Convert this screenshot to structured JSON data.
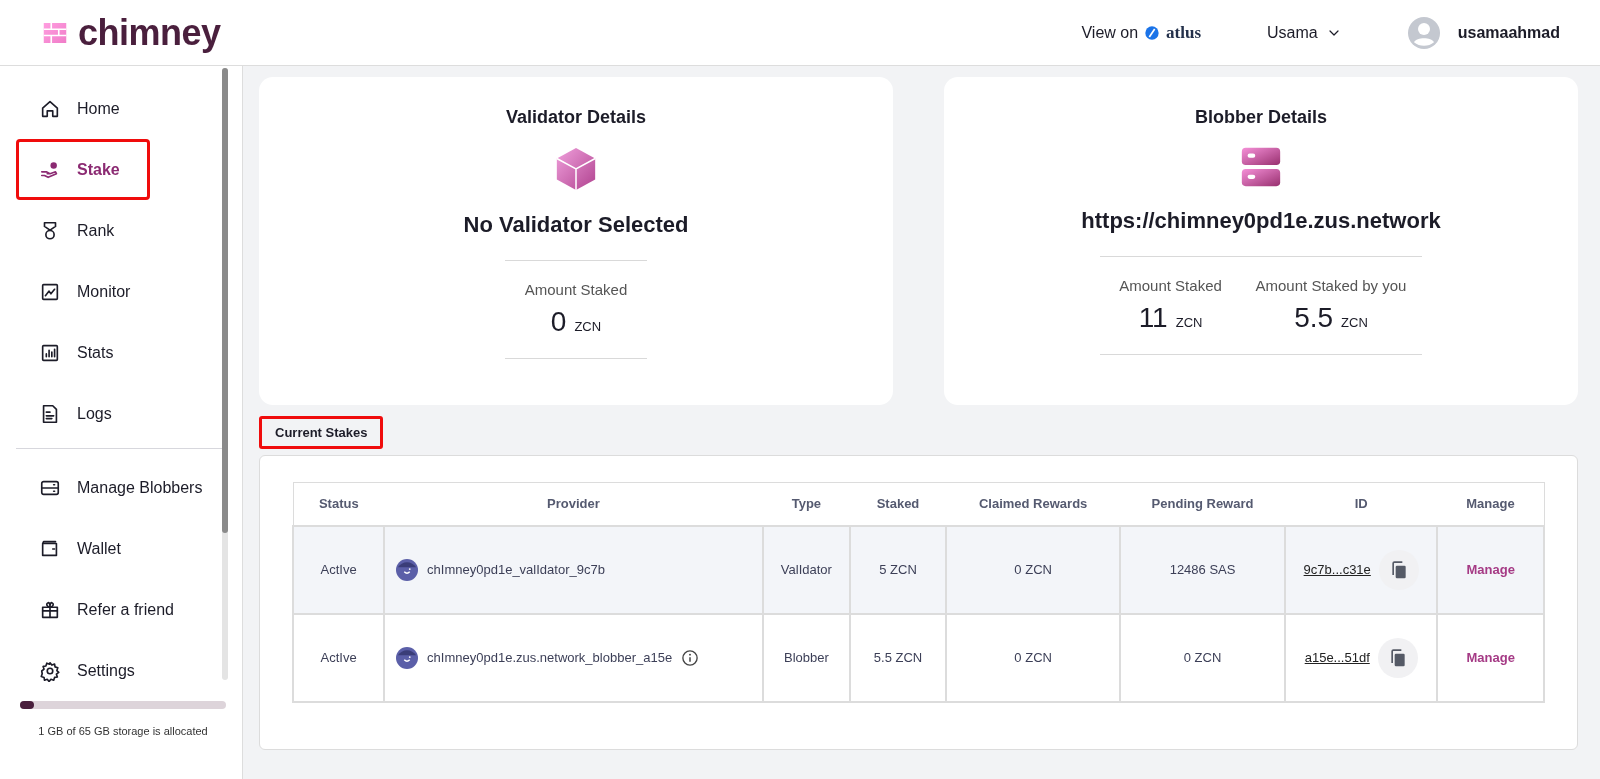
{
  "header": {
    "logo_text": "chimney",
    "view_on": "View on",
    "atlus": "atlus",
    "account": "Usama",
    "username": "usamaahmad"
  },
  "sidebar": {
    "items": [
      {
        "label": "Home",
        "selected": false,
        "annotated": false
      },
      {
        "label": "Stake",
        "selected": true,
        "annotated": true
      },
      {
        "label": "Rank",
        "selected": false,
        "annotated": false
      },
      {
        "label": "Monitor",
        "selected": false,
        "annotated": false
      },
      {
        "label": "Stats",
        "selected": false,
        "annotated": false
      },
      {
        "label": "Logs",
        "selected": false,
        "annotated": false
      },
      {
        "label": "Manage Blobbers",
        "selected": false,
        "annotated": false
      },
      {
        "label": "Wallet",
        "selected": false,
        "annotated": false
      },
      {
        "label": "Refer a friend",
        "selected": false,
        "annotated": false
      },
      {
        "label": "Settings",
        "selected": false,
        "annotated": false
      }
    ],
    "storage": {
      "level": 0.07,
      "text": "1 GB of 65 GB storage is allocated"
    }
  },
  "cards": [
    {
      "kind": "validator",
      "title": "Validator Details",
      "name": "No Validator Selected",
      "stats": [
        {
          "label": "Amount Staked",
          "value": "0",
          "unit": "ZCN"
        }
      ]
    },
    {
      "kind": "blobber",
      "title": "Blobber Details",
      "name": "https://chimney0pd1e.zus.network",
      "stats": [
        {
          "label": "Amount Staked",
          "value": "11",
          "unit": "ZCN"
        },
        {
          "label": "Amount Staked by you",
          "value": "5.5",
          "unit": "ZCN"
        }
      ]
    }
  ],
  "current_stakes": {
    "title": "Current Stakes",
    "annotated": true,
    "columns": [
      "Status",
      "Provider",
      "Type",
      "Staked",
      "Claimed Rewards",
      "Pending Reward",
      "ID",
      "Manage"
    ],
    "rows": [
      {
        "status": "ActIve",
        "provider": "chImney0pd1e_valIdator_9c7b",
        "info": false,
        "type": "ValIdator",
        "staked": "5 ZCN",
        "claimed": "0 ZCN",
        "pending": "12486 SAS",
        "id": "9c7b...c31e",
        "manage": "Manage",
        "highlighted": true
      },
      {
        "status": "ActIve",
        "provider": "chImney0pd1e.zus.network_blobber_a15e",
        "info": true,
        "type": "Blobber",
        "staked": "5.5 ZCN",
        "claimed": "0 ZCN",
        "pending": "0 ZCN",
        "id": "a15e...51df",
        "manage": "Manage",
        "highlighted": false
      }
    ]
  }
}
